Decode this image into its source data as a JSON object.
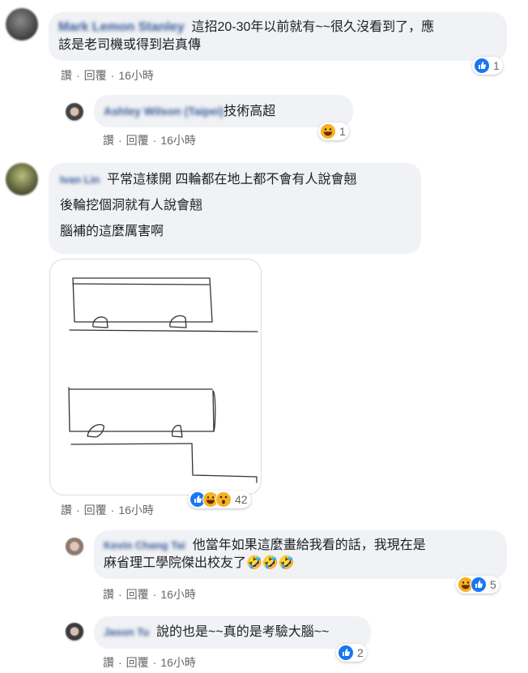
{
  "comments": [
    {
      "author": "Mark Lemon Stanley",
      "text_lines": [
        "這招20-30年以前就有~~很久沒看到了，應",
        "該是老司機或得到岩真傳"
      ],
      "actions": {
        "read": "讚",
        "reply": "回覆",
        "time": "16小時"
      },
      "reaction_count": "1"
    },
    {
      "author": "Ashley Wilson (Taipei)",
      "text_lines": [
        "技術高超"
      ],
      "actions": {
        "read": "讚",
        "reply": "回覆",
        "time": "16小時"
      },
      "reaction_count": "1"
    },
    {
      "author": "Ivan Lin",
      "text_lines": [
        "平常這樣開 四輪都在地上都不會有人說會翹",
        "後輪挖個洞就有人說會翹",
        "腦補的這麼厲害啊"
      ],
      "actions": {
        "read": "讚",
        "reply": "回覆",
        "time": "16小時"
      },
      "reaction_count": "42"
    },
    {
      "author": "Kevin Chang Tai",
      "text_lines": [
        "他當年如果這麼畫給我看的話，我現在是",
        "麻省理工學院傑出校友了🤣🤣🤣"
      ],
      "actions": {
        "read": "讚",
        "reply": "回覆",
        "time": "16小時"
      },
      "reaction_count": "5"
    },
    {
      "author": "Jason Tu",
      "text_lines": [
        "說的也是~~真的是考驗大腦~~"
      ],
      "actions": {
        "read": "讚",
        "reply": "回覆",
        "time": "16小時"
      },
      "reaction_count": "2"
    }
  ],
  "dot": "·",
  "colors": {
    "like": "#1877f2",
    "haha": "#f7b125",
    "bubble": "#f0f2f5",
    "meta": "#65676b"
  }
}
